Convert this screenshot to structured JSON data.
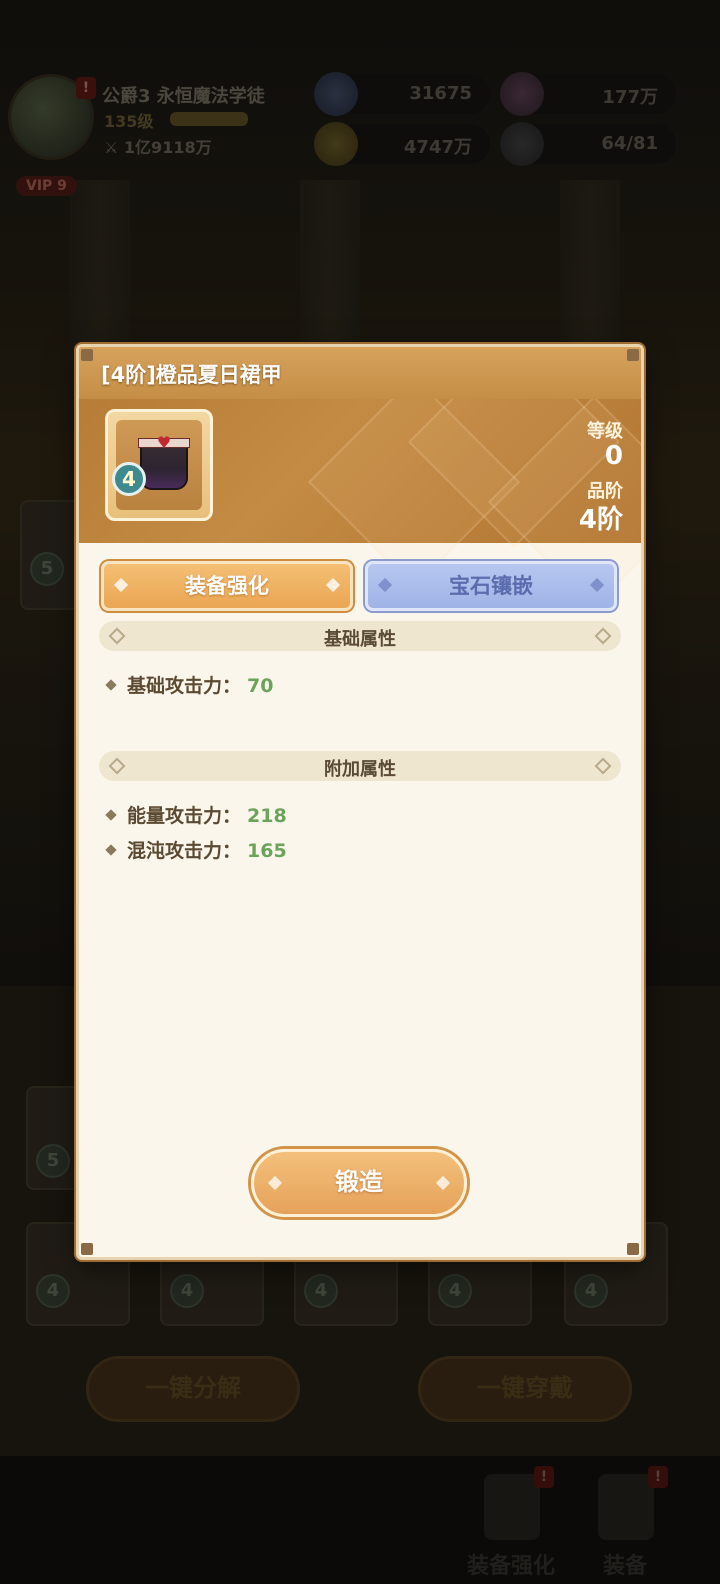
{
  "hud": {
    "title": "公爵3 永恒魔法学徒",
    "level": "135级",
    "power": "1亿9118万",
    "vip": "VIP 9",
    "alert": "!",
    "resources": [
      {
        "icon": "star-plus-icon",
        "value": "31675"
      },
      {
        "icon": "swirl-token-icon",
        "value": "177万"
      },
      {
        "icon": "gold-coin-plus-icon",
        "value": "4747万"
      },
      {
        "icon": "group-icon",
        "value": "64/81"
      }
    ]
  },
  "background": {
    "card_badges": [
      "5",
      "5",
      "4",
      "4",
      "4",
      "4",
      "4"
    ],
    "buttons": [
      "一键分解",
      "一键穿戴"
    ],
    "nav": [
      {
        "label": "装备强化",
        "icon": "hammer-icon",
        "alert": "!"
      },
      {
        "label": "装备",
        "icon": "sword-icon",
        "alert": "!"
      }
    ]
  },
  "dialog": {
    "title": "[4阶]橙品夏日裙甲",
    "item": {
      "icon": "summer-skirt-armor-icon",
      "tier_badge": "4"
    },
    "stats": [
      {
        "label": "等级",
        "value": "0"
      },
      {
        "label": "品阶",
        "value": "4阶"
      }
    ],
    "tabs": [
      {
        "label": "装备强化",
        "active": true
      },
      {
        "label": "宝石镶嵌",
        "active": false
      }
    ],
    "sections": [
      {
        "title": "基础属性",
        "attributes": [
          {
            "name": "基础攻击力：",
            "value": "70"
          }
        ]
      },
      {
        "title": "附加属性",
        "attributes": [
          {
            "name": "能量攻击力：",
            "value": "218"
          },
          {
            "name": "混沌攻击力：",
            "value": "165"
          }
        ]
      }
    ],
    "forge_button": "锻造"
  },
  "colors": {
    "header_orange": "#c38b44",
    "active_tab": "#eaa653",
    "inactive_tab": "#9fb3e6",
    "attr_value_green": "#6ba35a",
    "panel_bg": "#fbf6ec"
  }
}
